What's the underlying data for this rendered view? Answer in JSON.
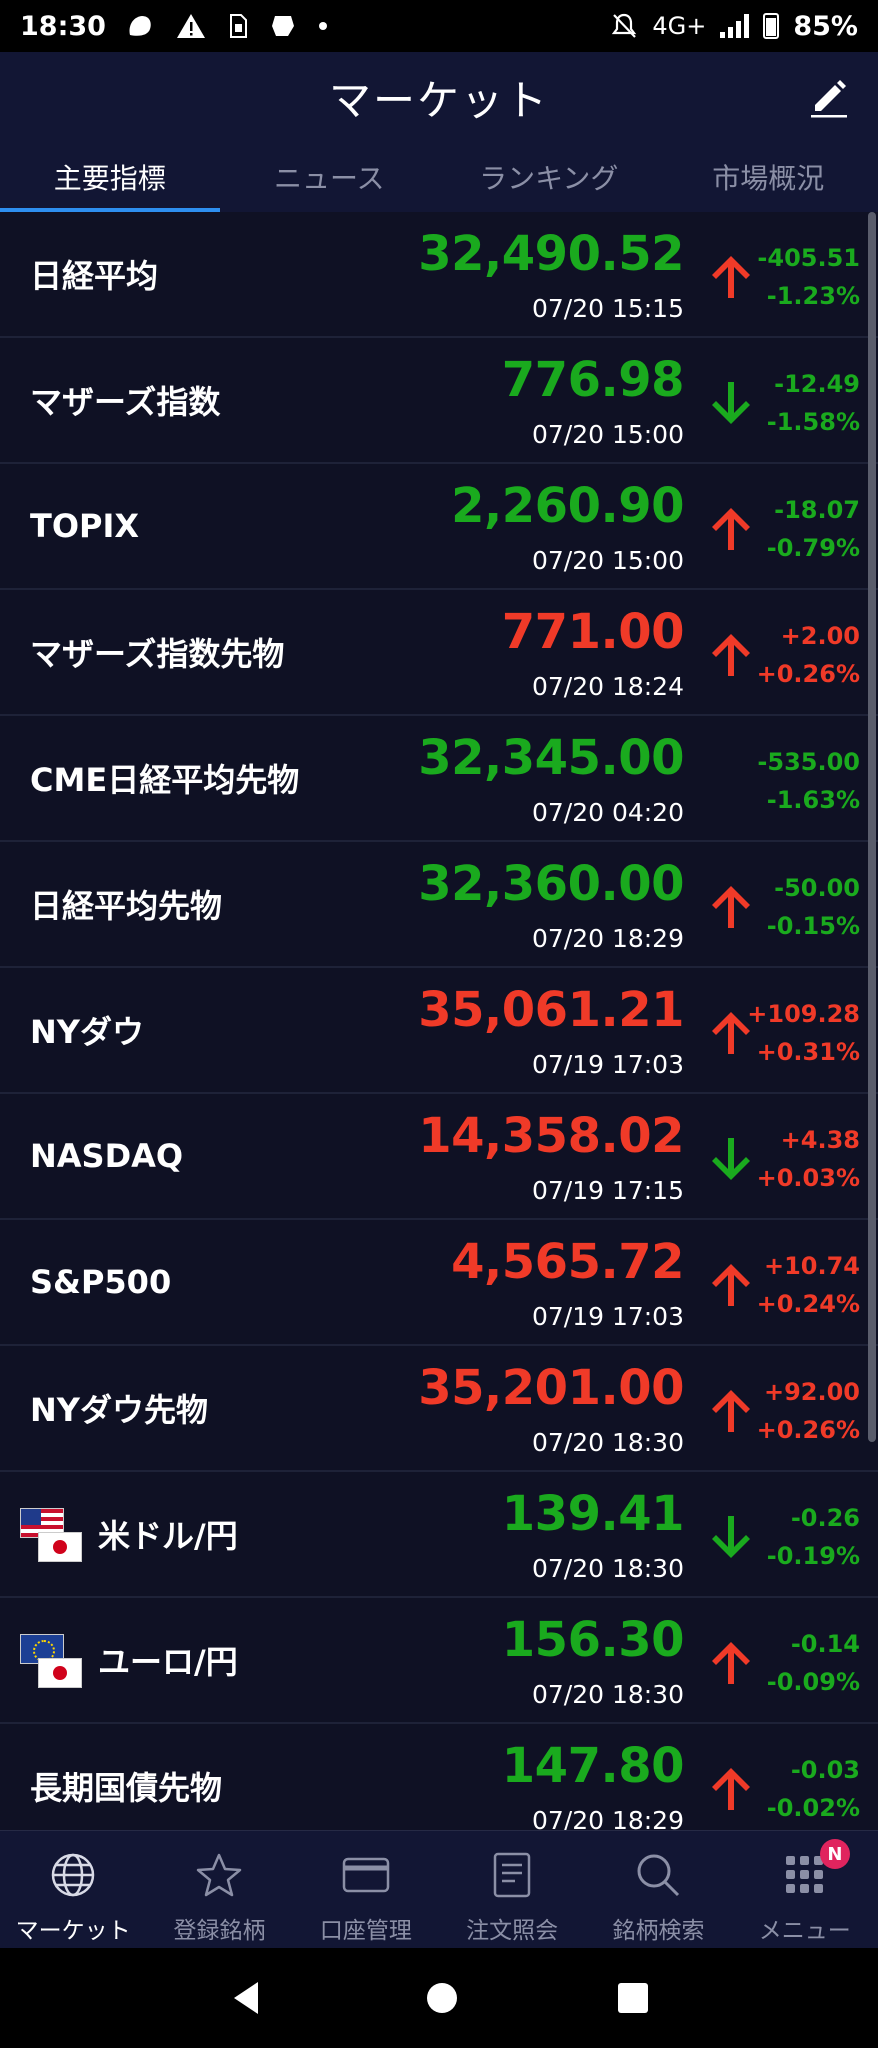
{
  "status_bar": {
    "time": "18:30",
    "network": "4G+",
    "battery": "85%",
    "icons": [
      "app-notification-icon",
      "warning-icon",
      "sim-icon",
      "app-icon",
      "dot-icon",
      "mute-icon",
      "signal-icon",
      "battery-icon"
    ]
  },
  "header": {
    "title": "マーケット",
    "edit_icon": "pencil-icon"
  },
  "tabs": [
    {
      "label": "主要指標",
      "active": true
    },
    {
      "label": "ニュース",
      "active": false
    },
    {
      "label": "ランキング",
      "active": false
    },
    {
      "label": "市場概況",
      "active": false
    }
  ],
  "colors": {
    "up": "#f03a28",
    "down": "#1aaa1e",
    "background": "#0d0f1f",
    "header": "#121634",
    "accent": "#2e8ff0"
  },
  "market_rows": [
    {
      "name": "日経平均",
      "price": "32,490.52",
      "time": "07/20 15:15",
      "change": "-405.51",
      "change_pct": "-1.23%",
      "price_color": "green",
      "change_color": "green",
      "arrow": "up"
    },
    {
      "name": "マザーズ指数",
      "price": "776.98",
      "time": "07/20 15:00",
      "change": "-12.49",
      "change_pct": "-1.58%",
      "price_color": "green",
      "change_color": "green",
      "arrow": "down"
    },
    {
      "name": "TOPIX",
      "price": "2,260.90",
      "time": "07/20 15:00",
      "change": "-18.07",
      "change_pct": "-0.79%",
      "price_color": "green",
      "change_color": "green",
      "arrow": "up"
    },
    {
      "name": "マザーズ指数先物",
      "price": "771.00",
      "time": "07/20 18:24",
      "change": "+2.00",
      "change_pct": "+0.26%",
      "price_color": "red",
      "change_color": "red",
      "arrow": "up"
    },
    {
      "name": "CME日経平均先物",
      "price": "32,345.00",
      "time": "07/20 04:20",
      "change": "-535.00",
      "change_pct": "-1.63%",
      "price_color": "green",
      "change_color": "green",
      "arrow": "none"
    },
    {
      "name": "日経平均先物",
      "price": "32,360.00",
      "time": "07/20 18:29",
      "change": "-50.00",
      "change_pct": "-0.15%",
      "price_color": "green",
      "change_color": "green",
      "arrow": "up"
    },
    {
      "name": "NYダウ",
      "price": "35,061.21",
      "time": "07/19 17:03",
      "change": "+109.28",
      "change_pct": "+0.31%",
      "price_color": "red",
      "change_color": "red",
      "arrow": "up"
    },
    {
      "name": "NASDAQ",
      "price": "14,358.02",
      "time": "07/19 17:15",
      "change": "+4.38",
      "change_pct": "+0.03%",
      "price_color": "red",
      "change_color": "red",
      "arrow": "down"
    },
    {
      "name": "S&P500",
      "price": "4,565.72",
      "time": "07/19 17:03",
      "change": "+10.74",
      "change_pct": "+0.24%",
      "price_color": "red",
      "change_color": "red",
      "arrow": "up"
    },
    {
      "name": "NYダウ先物",
      "price": "35,201.00",
      "time": "07/20 18:30",
      "change": "+92.00",
      "change_pct": "+0.26%",
      "price_color": "red",
      "change_color": "red",
      "arrow": "up"
    },
    {
      "name": "米ドル/円",
      "price": "139.41",
      "time": "07/20 18:30",
      "change": "-0.26",
      "change_pct": "-0.19%",
      "price_color": "green",
      "change_color": "green",
      "arrow": "down",
      "flag": "us-jp-flag-icon"
    },
    {
      "name": "ユーロ/円",
      "price": "156.30",
      "time": "07/20 18:30",
      "change": "-0.14",
      "change_pct": "-0.09%",
      "price_color": "green",
      "change_color": "green",
      "arrow": "up",
      "flag": "eu-jp-flag-icon"
    },
    {
      "name": "長期国債先物",
      "price": "147.80",
      "time": "07/20 18:29",
      "change": "-0.03",
      "change_pct": "-0.02%",
      "price_color": "green",
      "change_color": "green",
      "arrow": "up"
    }
  ],
  "bottom_nav": [
    {
      "label": "マーケット",
      "icon": "globe-icon",
      "active": true
    },
    {
      "label": "登録銘柄",
      "icon": "star-icon",
      "active": false
    },
    {
      "label": "口座管理",
      "icon": "card-icon",
      "active": false
    },
    {
      "label": "注文照会",
      "icon": "document-icon",
      "active": false
    },
    {
      "label": "銘柄検索",
      "icon": "search-icon",
      "active": false
    },
    {
      "label": "メニュー",
      "icon": "grid-menu-icon",
      "active": false,
      "badge": "N"
    }
  ],
  "system_nav": {
    "back_icon": "back-triangle-icon",
    "home_icon": "home-circle-icon",
    "recents_icon": "recents-square-icon"
  }
}
